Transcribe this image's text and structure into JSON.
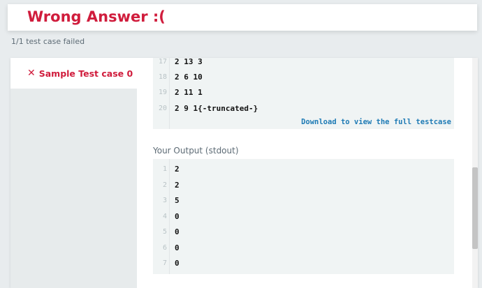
{
  "result": {
    "title": "Wrong Answer :(",
    "summary": "1/1 test case failed"
  },
  "sidebar": {
    "tabs": [
      {
        "label": "Sample Test case 0",
        "status_icon": "close-icon"
      }
    ]
  },
  "input": {
    "lines": [
      {
        "no": "17",
        "text": "2 13 3"
      },
      {
        "no": "18",
        "text": "2 6 10"
      },
      {
        "no": "19",
        "text": "2 11 1"
      },
      {
        "no": "20",
        "text": "2 9 1{-truncated-}"
      }
    ],
    "download_label": "Download to view the full testcase"
  },
  "output": {
    "label": "Your Output (stdout)",
    "lines": [
      {
        "no": "1",
        "text": "2"
      },
      {
        "no": "2",
        "text": "2"
      },
      {
        "no": "3",
        "text": "5"
      },
      {
        "no": "4",
        "text": "0"
      },
      {
        "no": "5",
        "text": "0"
      },
      {
        "no": "6",
        "text": "0"
      },
      {
        "no": "7",
        "text": "0"
      }
    ]
  },
  "colors": {
    "error": "#d01c3c",
    "link": "#1f7bb5",
    "code_bg": "#f0f4f4"
  }
}
